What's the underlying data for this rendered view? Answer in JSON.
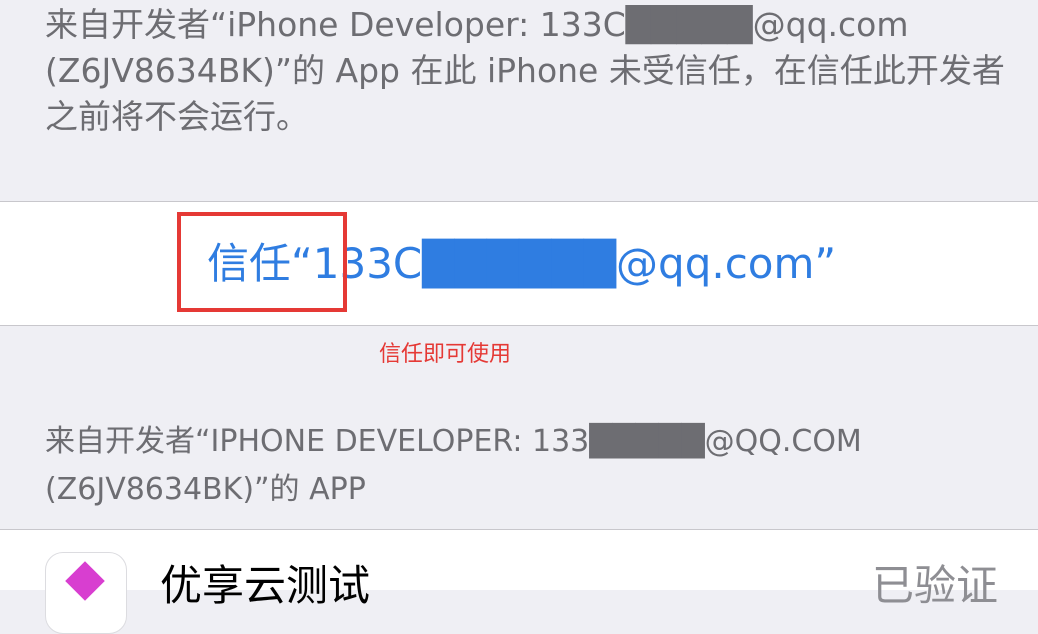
{
  "description": {
    "text": "来自开发者“iPhone Developer: 133C█████@qq.com (Z6JV8634BK)”的 App 在此 iPhone 未受信任，在信任此开发者之前将不会运行。"
  },
  "trust_button": {
    "label": "信任“133C██████@qq.com”"
  },
  "annotation": {
    "text": "信任即可使用"
  },
  "apps_section": {
    "header": "来自开发者“IPHONE DEVELOPER: 133█████@QQ.COM (Z6JV8634BK)”的 APP",
    "items": [
      {
        "name": "优享云测试",
        "action": "已验证",
        "icon": "purple-diamond-app-icon"
      }
    ]
  },
  "colors": {
    "background": "#efeff4",
    "link_blue": "#2f7de1",
    "annotation_red": "#e53935",
    "secondary_text": "#6d6d72"
  }
}
